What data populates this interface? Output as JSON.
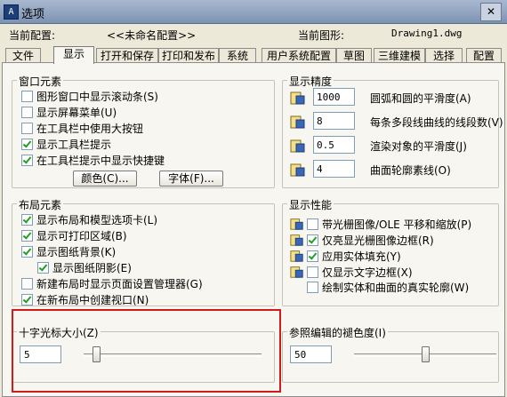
{
  "window": {
    "title": "选项",
    "app_icon": "autocad-icon",
    "close_label": "✕"
  },
  "config": {
    "current_config_label": "当前配置:",
    "current_config_value": "<<未命名配置>>",
    "current_drawing_label": "当前图形:",
    "current_drawing_value": "Drawing1.dwg"
  },
  "tabs": [
    {
      "label": "文件"
    },
    {
      "label": "显示"
    },
    {
      "label": "打开和保存"
    },
    {
      "label": "打印和发布"
    },
    {
      "label": "系统"
    },
    {
      "label": "用户系统配置"
    },
    {
      "label": "草图"
    },
    {
      "label": "三维建模"
    },
    {
      "label": "选择"
    },
    {
      "label": "配置"
    }
  ],
  "window_elements": {
    "title": "窗口元素",
    "items": [
      {
        "label": "图形窗口中显示滚动条(S)",
        "checked": false
      },
      {
        "label": "显示屏幕菜单(U)",
        "checked": false
      },
      {
        "label": "在工具栏中使用大按钮",
        "checked": false
      },
      {
        "label": "显示工具栏提示",
        "checked": true
      },
      {
        "label": "在工具栏提示中显示快捷键",
        "checked": true
      }
    ],
    "colors_button": "颜色(C)...",
    "fonts_button": "字体(F)..."
  },
  "display_precision": {
    "title": "显示精度",
    "items": [
      {
        "value": "1000",
        "label": "圆弧和圆的平滑度(A)"
      },
      {
        "value": "8",
        "label": "每条多段线曲线的线段数(V)"
      },
      {
        "value": "0.5",
        "label": "渲染对象的平滑度(J)"
      },
      {
        "value": "4",
        "label": "曲面轮廓素线(O)"
      }
    ]
  },
  "layout_elements": {
    "title": "布局元素",
    "items": [
      {
        "label": "显示布局和模型选项卡(L)",
        "checked": true
      },
      {
        "label": "显示可打印区域(B)",
        "checked": true
      },
      {
        "label": "显示图纸背景(K)",
        "checked": true
      },
      {
        "label": "显示图纸阴影(E)",
        "checked": true
      },
      {
        "label": "新建布局时显示页面设置管理器(G)",
        "checked": false
      },
      {
        "label": "在新布局中创建视口(N)",
        "checked": true
      }
    ]
  },
  "display_performance": {
    "title": "显示性能",
    "items": [
      {
        "label": "带光栅图像/OLE 平移和缩放(P)",
        "checked": false
      },
      {
        "label": "仅亮显光栅图像边框(R)",
        "checked": true
      },
      {
        "label": "应用实体填充(Y)",
        "checked": true
      },
      {
        "label": "仅显示文字边框(X)",
        "checked": false
      },
      {
        "label": "绘制实体和曲面的真实轮廓(W)",
        "checked": false
      }
    ]
  },
  "crosshair": {
    "title": "十字光标大小(Z)",
    "value": "5",
    "fraction": 0.05
  },
  "xref_fade": {
    "title": "参照编辑的褪色度(I)",
    "value": "50",
    "fraction": 0.5
  }
}
